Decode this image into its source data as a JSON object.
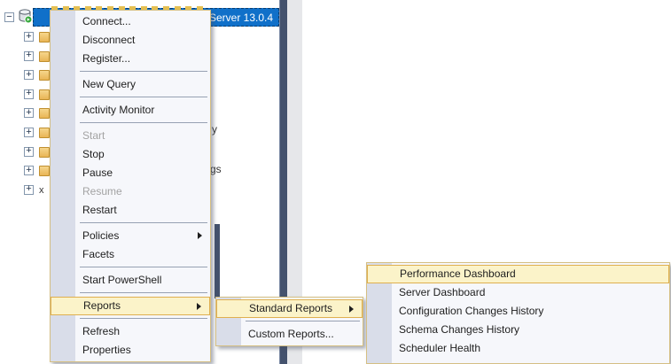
{
  "object_explorer": {
    "server_node": {
      "visible_label": "Server 13.0.4"
    },
    "child_row_count": 9,
    "fragments": {
      "row6_tail": "y",
      "row8_tail": "gs",
      "row9_start": "x"
    },
    "redaction_dash_count": 14
  },
  "menus": [
    {
      "id": "context-menu",
      "items": [
        {
          "type": "command",
          "label": "Connect..."
        },
        {
          "type": "command",
          "label": "Disconnect"
        },
        {
          "type": "command",
          "label": "Register..."
        },
        {
          "type": "separator"
        },
        {
          "type": "command",
          "label": "New Query"
        },
        {
          "type": "separator"
        },
        {
          "type": "command",
          "label": "Activity Monitor"
        },
        {
          "type": "separator"
        },
        {
          "type": "command",
          "label": "Start",
          "disabled": true
        },
        {
          "type": "command",
          "label": "Stop"
        },
        {
          "type": "command",
          "label": "Pause"
        },
        {
          "type": "command",
          "label": "Resume",
          "disabled": true
        },
        {
          "type": "command",
          "label": "Restart"
        },
        {
          "type": "separator"
        },
        {
          "type": "command",
          "label": "Policies",
          "submenu": true
        },
        {
          "type": "command",
          "label": "Facets"
        },
        {
          "type": "separator"
        },
        {
          "type": "command",
          "label": "Start PowerShell"
        },
        {
          "type": "separator"
        },
        {
          "type": "command",
          "label": "Reports",
          "submenu": true,
          "highlighted": true
        },
        {
          "type": "separator"
        },
        {
          "type": "command",
          "label": "Refresh"
        },
        {
          "type": "command",
          "label": "Properties"
        }
      ]
    },
    {
      "id": "reports-submenu",
      "items": [
        {
          "type": "command",
          "label": "Standard Reports",
          "submenu": true,
          "highlighted": true
        },
        {
          "type": "separator"
        },
        {
          "type": "command",
          "label": "Custom Reports..."
        }
      ]
    },
    {
      "id": "standard-reports-submenu",
      "items": [
        {
          "type": "command",
          "label": "Performance Dashboard",
          "highlighted": true
        },
        {
          "type": "command",
          "label": "Server Dashboard"
        },
        {
          "type": "command",
          "label": "Configuration Changes History"
        },
        {
          "type": "command",
          "label": "Schema Changes History"
        },
        {
          "type": "command",
          "label": "Scheduler Health"
        }
      ]
    }
  ],
  "colors": {
    "selection": "#1070C9",
    "hl_bg": "#FBF3C9",
    "hl_border": "#DFAF4F",
    "menu_border": "#D5BF83",
    "panel_bar": "#44526D"
  }
}
